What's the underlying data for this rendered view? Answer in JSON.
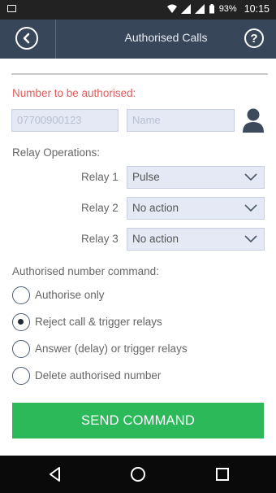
{
  "status_bar": {
    "battery": "93%",
    "time": "10:15"
  },
  "app_bar": {
    "title": "Authorised Calls"
  },
  "number_section": {
    "label": "Number to be authorised:",
    "phone_placeholder": "07700900123",
    "name_placeholder": "Name"
  },
  "relay_section": {
    "label": "Relay Operations:",
    "relays": [
      {
        "label": "Relay 1",
        "value": "Pulse"
      },
      {
        "label": "Relay 2",
        "value": "No action"
      },
      {
        "label": "Relay 3",
        "value": "No action"
      }
    ]
  },
  "command_section": {
    "label": "Authorised number command:",
    "options": [
      {
        "label": "Authorise only",
        "selected": false
      },
      {
        "label": "Reject call & trigger relays",
        "selected": true
      },
      {
        "label": "Answer (delay) or trigger relays",
        "selected": false
      },
      {
        "label": "Delete authorised number",
        "selected": false
      }
    ]
  },
  "send_button": {
    "label": "SEND COMMAND"
  },
  "icons": [
    "back-icon",
    "help-icon",
    "contact-person-icon",
    "chevron-down-icon",
    "nav-back-icon",
    "nav-home-icon",
    "nav-recents-icon"
  ],
  "colors": {
    "app_bar": "#374659",
    "accent_label": "#e05c5c",
    "send_button": "#2bb95a",
    "input_bg": "#e4e9f5"
  }
}
